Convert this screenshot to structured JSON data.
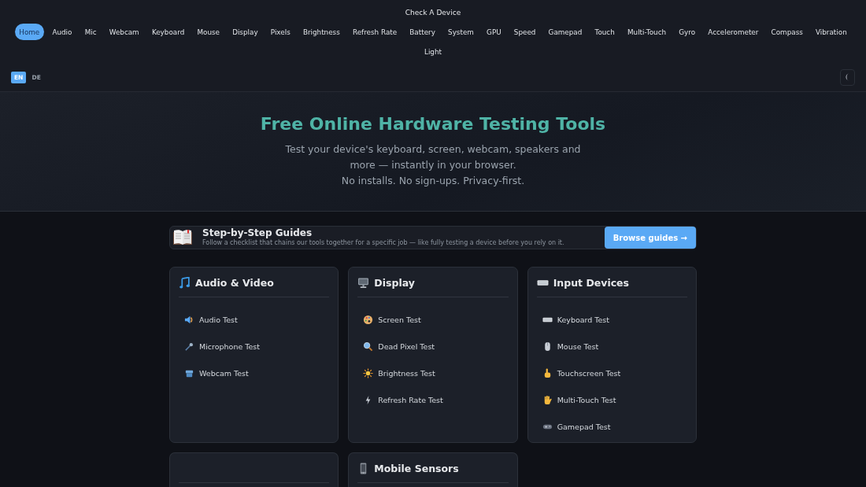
{
  "site_title": "Check A Device",
  "nav": [
    {
      "label": "Home",
      "selected": true
    },
    {
      "label": "Audio",
      "selected": false
    },
    {
      "label": "Mic",
      "selected": false
    },
    {
      "label": "Webcam",
      "selected": false
    },
    {
      "label": "Keyboard",
      "selected": false
    },
    {
      "label": "Mouse",
      "selected": false
    },
    {
      "label": "Display",
      "selected": false
    },
    {
      "label": "Pixels",
      "selected": false
    },
    {
      "label": "Brightness",
      "selected": false
    },
    {
      "label": "Refresh Rate",
      "selected": false
    },
    {
      "label": "Battery",
      "selected": false
    },
    {
      "label": "System",
      "selected": false
    },
    {
      "label": "GPU",
      "selected": false
    },
    {
      "label": "Speed",
      "selected": false
    },
    {
      "label": "Gamepad",
      "selected": false
    },
    {
      "label": "Touch",
      "selected": false
    },
    {
      "label": "Multi-Touch",
      "selected": false
    },
    {
      "label": "Gyro",
      "selected": false
    },
    {
      "label": "Accelerometer",
      "selected": false
    },
    {
      "label": "Compass",
      "selected": false
    },
    {
      "label": "Vibration",
      "selected": false
    },
    {
      "label": "Light",
      "selected": false
    }
  ],
  "languages": [
    {
      "label": "EN",
      "selected": true
    },
    {
      "label": "DE",
      "selected": false
    }
  ],
  "hero": {
    "title": "Free Online Hardware Testing Tools",
    "subtitle_lines": [
      "Test your device's keyboard, screen, webcam, speakers and",
      "more — instantly in your browser.",
      "No installs. No sign-ups. Privacy-first."
    ]
  },
  "guides": {
    "title": "Step-by-Step Guides",
    "description": "Follow a checklist that chains our tools together for a specific job — like fully testing a device before you rely on it.",
    "button": "Browse guides →"
  },
  "categories": [
    {
      "kind": "tools",
      "title": "Audio & Video",
      "items": [
        "Audio Test",
        "Microphone Test",
        "Webcam Test"
      ]
    },
    {
      "kind": "tools",
      "title": "Display",
      "items": [
        "Screen Test",
        "Dead Pixel Test",
        "Brightness Test",
        "Refresh Rate Test"
      ]
    },
    {
      "kind": "tools",
      "title": "Input Devices",
      "items": [
        "Keyboard Test",
        "Mouse Test",
        "Touchscreen Test",
        "Multi-Touch Test",
        "Gamepad Test"
      ]
    },
    {
      "kind": "blank"
    },
    {
      "kind": "tools",
      "title": "Mobile Sensors"
    }
  ]
}
